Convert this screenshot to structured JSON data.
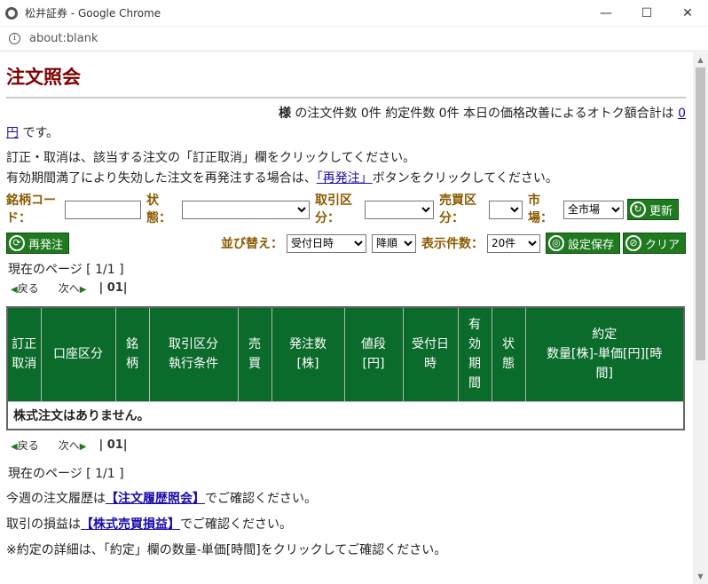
{
  "window": {
    "title": "松井証券 - Google Chrome",
    "url": "about:blank",
    "minimize": "—",
    "maximize": "☐",
    "close": "✕"
  },
  "page": {
    "title": "注文照会",
    "summary": {
      "honorific": "様",
      "text": " の注文件数 0件 約定件数 0件 本日の価格改善によるオトク額合計は ",
      "amount": "0",
      "unit": "円",
      "tail": " です。"
    },
    "notes": {
      "line1": "訂正・取消は、該当する注文の「訂正取消」欄をクリックしてください。",
      "line2_pre": "有効期間満了により失効した注文を再発注する場合は、",
      "line2_link": "「再発注」",
      "line2_post": "ボタンをクリックしてください。"
    },
    "filters": {
      "code_label": "銘柄コード：",
      "status_label": "状態：",
      "trade_type_label": "取引区分：",
      "side_label": "売買区分：",
      "market_label": "市場：",
      "market_value": "全市場",
      "update_button": "更新"
    },
    "toolbar": {
      "reorder_button": "再発注",
      "sort_label": "並び替え：",
      "sort_value": "受付日時",
      "order_value": "降順",
      "count_label": "表示件数：",
      "count_value": "20件",
      "save_button": "設定保存",
      "clear_button": "クリア"
    },
    "pager": {
      "current": "現在のページ [ 1/1 ]",
      "prev": "戻る",
      "next": "次へ",
      "page": "| 01|"
    },
    "table": {
      "headers": [
        "訂正\n取消",
        "口座区分",
        "銘\n柄",
        "取引区分\n執行条件",
        "売\n買",
        "発注数\n[株]",
        "値段\n[円]",
        "受付日\n時",
        "有\n効\n期\n間",
        "状\n態",
        "約定\n数量[株]-単価[円][時\n間]"
      ],
      "empty_message": "株式注文はありません。"
    },
    "footer": {
      "history_pre": "今週の注文履歴は",
      "history_link": "【注文履歴照会】",
      "history_post": "でご確認ください。",
      "pnl_pre": "取引の損益は",
      "pnl_link": "【株式売買損益】",
      "pnl_post": "でご確認ください。",
      "detail_note": "※約定の詳細は、「約定」欄の数量-単価[時間]をクリックしてご確認ください。"
    }
  }
}
